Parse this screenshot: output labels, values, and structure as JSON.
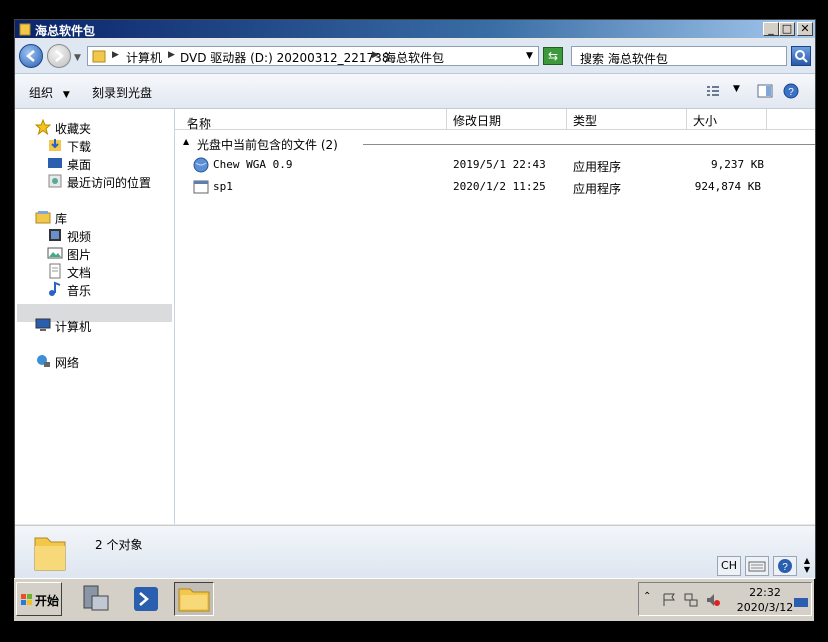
{
  "window": {
    "title": "海总软件包",
    "btn_min": "_",
    "btn_max": "□",
    "btn_close": "✕"
  },
  "address": {
    "crumbs": [
      "计算机",
      "DVD 驱动器 (D:) 20200312_221738",
      "海总软件包"
    ],
    "search_placeholder": "搜索 海总软件包"
  },
  "toolbar": {
    "organize": "组织",
    "burn": "刻录到光盘"
  },
  "nav": {
    "favorites": "收藏夹",
    "downloads": "下载",
    "desktop": "桌面",
    "recent": "最近访问的位置",
    "libraries": "库",
    "videos": "视频",
    "pictures": "图片",
    "documents": "文档",
    "music": "音乐",
    "computer": "计算机",
    "network": "网络"
  },
  "list": {
    "columns": {
      "name": "名称",
      "date": "修改日期",
      "type": "类型",
      "size": "大小"
    },
    "group_label": "光盘中当前包含的文件 (2)",
    "files": [
      {
        "name": "Chew WGA 0.9",
        "date": "2019/5/1 22:43",
        "type": "应用程序",
        "size": "9,237 KB"
      },
      {
        "name": "sp1",
        "date": "2020/1/2 11:25",
        "type": "应用程序",
        "size": "924,874 KB"
      }
    ]
  },
  "status": {
    "count": "2 个对象",
    "lang": "CH"
  },
  "taskbar": {
    "start": "开始",
    "time": "22:32",
    "date": "2020/3/12"
  },
  "colors": {
    "title_start": "#0a246a",
    "title_end": "#a6caf0",
    "selection": "#dadbdd"
  }
}
